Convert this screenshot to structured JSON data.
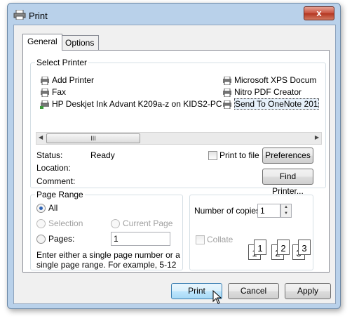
{
  "window": {
    "title": "Print",
    "close_label": "x"
  },
  "tabs": [
    {
      "label": "General"
    },
    {
      "label": "Options"
    }
  ],
  "select_printer": {
    "group_label": "Select Printer",
    "printers": [
      {
        "label": "Add Printer"
      },
      {
        "label": "Fax"
      },
      {
        "label": "HP Deskjet Ink Advant K209a-z on KIDS2-PC"
      },
      {
        "label": "Microsoft XPS Docum"
      },
      {
        "label": "Nitro PDF Creator"
      },
      {
        "label": "Send To OneNote 201"
      }
    ],
    "scroll_thumb": "III",
    "status_label": "Status:",
    "status_value": "Ready",
    "location_label": "Location:",
    "comment_label": "Comment:",
    "print_to_file_label": "Print to file",
    "preferences_label": "Preferences",
    "find_printer_label": "Find Printer..."
  },
  "page_range": {
    "group_label": "Page Range",
    "all_label": "All",
    "selection_label": "Selection",
    "current_page_label": "Current Page",
    "pages_label": "Pages:",
    "pages_value": "1",
    "hint": "Enter either a single page number or a single page range.  For example, 5-12"
  },
  "copies": {
    "number_label": "Number of copies:",
    "number_value": "1",
    "collate_label": "Collate",
    "collate_pages": [
      "1",
      "1",
      "2",
      "2",
      "3",
      "3"
    ]
  },
  "footer": {
    "print_label": "Print",
    "cancel_label": "Cancel",
    "apply_label": "Apply"
  }
}
